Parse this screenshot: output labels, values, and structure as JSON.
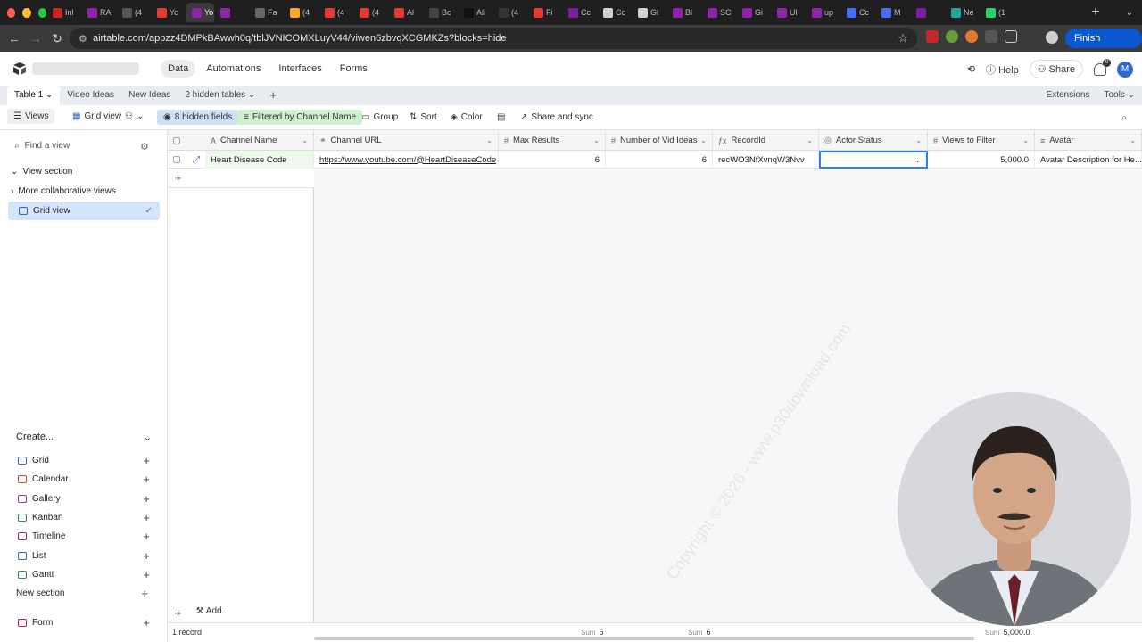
{
  "browser": {
    "tabs": [
      "Inl",
      "RA",
      "(4",
      "Yo",
      "Yo",
      "",
      "Fa",
      "(4",
      "(4",
      "(4",
      "Al",
      "Bc",
      "Ali",
      "(4",
      "Fi",
      "Cc",
      "Cc",
      "Gl",
      "Bl",
      "SC",
      "Gi",
      "Ul",
      "up",
      "Cc",
      "M",
      "",
      "Ne",
      "(1"
    ],
    "tab_colors": [
      "#c62828",
      "#8e24aa",
      "#555",
      "#e53935",
      "#8e24aa",
      "#8e24aa",
      "#666",
      "#f9a825",
      "#e53935",
      "#e53935",
      "#e53935",
      "#444",
      "#111",
      "#333",
      "#e53935",
      "#7b1fa2",
      "#cfcfcf",
      "#cfcfcf",
      "#8e24aa",
      "#8e24aa",
      "#8e24aa",
      "#8e24aa",
      "#8e24aa",
      "#4a6cf7",
      "#4a6cf7",
      "#7b1fa2",
      "#26a69a",
      "#25d366"
    ],
    "url": "airtable.com/appzz4DMPkBAwwh0q/tblJVNICOMXLuyV44/viwen6zbvqXCGMKZs?blocks=hide",
    "finish_update": "Finish update"
  },
  "header": {
    "nav": [
      "Data",
      "Automations",
      "Interfaces",
      "Forms"
    ],
    "active_nav": "Data",
    "help": "Help",
    "share": "Share",
    "avatar_initial": "M",
    "notif_count": "0"
  },
  "tablebar": {
    "tables": [
      "Table 1",
      "Video Ideas",
      "New Ideas",
      "2 hidden tables"
    ],
    "extensions": "Extensions",
    "tools": "Tools"
  },
  "viewbar": {
    "views": "Views",
    "grid_view": "Grid view",
    "hidden_fields": "8 hidden fields",
    "filter": "Filtered by Channel Name",
    "group": "Group",
    "sort": "Sort",
    "color": "Color",
    "share_sync": "Share and sync"
  },
  "sidebar": {
    "find_placeholder": "Find a view",
    "view_section": "View section",
    "more_collab": "More collaborative views",
    "grid_view": "Grid view",
    "create": "Create...",
    "create_items": [
      {
        "label": "Grid",
        "color": "#3b66c7"
      },
      {
        "label": "Calendar",
        "color": "#d04b1f"
      },
      {
        "label": "Gallery",
        "color": "#7b3fb4"
      },
      {
        "label": "Kanban",
        "color": "#2e8b57"
      },
      {
        "label": "Timeline",
        "color": "#c2185b"
      },
      {
        "label": "List",
        "color": "#3b66c7"
      },
      {
        "label": "Gantt",
        "color": "#2e8b57"
      }
    ],
    "new_section": "New section",
    "form": "Form"
  },
  "grid": {
    "columns": [
      {
        "name": "Channel Name",
        "icon": "A"
      },
      {
        "name": "Channel URL",
        "icon": "⚭"
      },
      {
        "name": "Max Results",
        "icon": "#"
      },
      {
        "name": "Number of Vid Ideas",
        "icon": "#"
      },
      {
        "name": "RecordId",
        "icon": "ƒx"
      },
      {
        "name": "Actor Status",
        "icon": "◎"
      },
      {
        "name": "Views to Filter",
        "icon": "#"
      },
      {
        "name": "Avatar",
        "icon": "≡"
      }
    ],
    "row": {
      "channel_name": "Heart Disease Code",
      "channel_url": "https://www.youtube.com/@HeartDiseaseCode",
      "max_results": "6",
      "num_vid_ideas": "6",
      "record_id": "recWO3NfXvnqW3Nvv",
      "actor_status": "",
      "views_to_filter": "5,000.0",
      "avatar": "Avatar Description for He..."
    },
    "footer": {
      "records": "1 record",
      "sum_label": "Sum",
      "sum_max": "6",
      "sum_vid": "6",
      "sum_views": "5,000.0"
    },
    "add_label": "Add...",
    "watermark": "Copyright © 2026 - www.p30download.com"
  }
}
